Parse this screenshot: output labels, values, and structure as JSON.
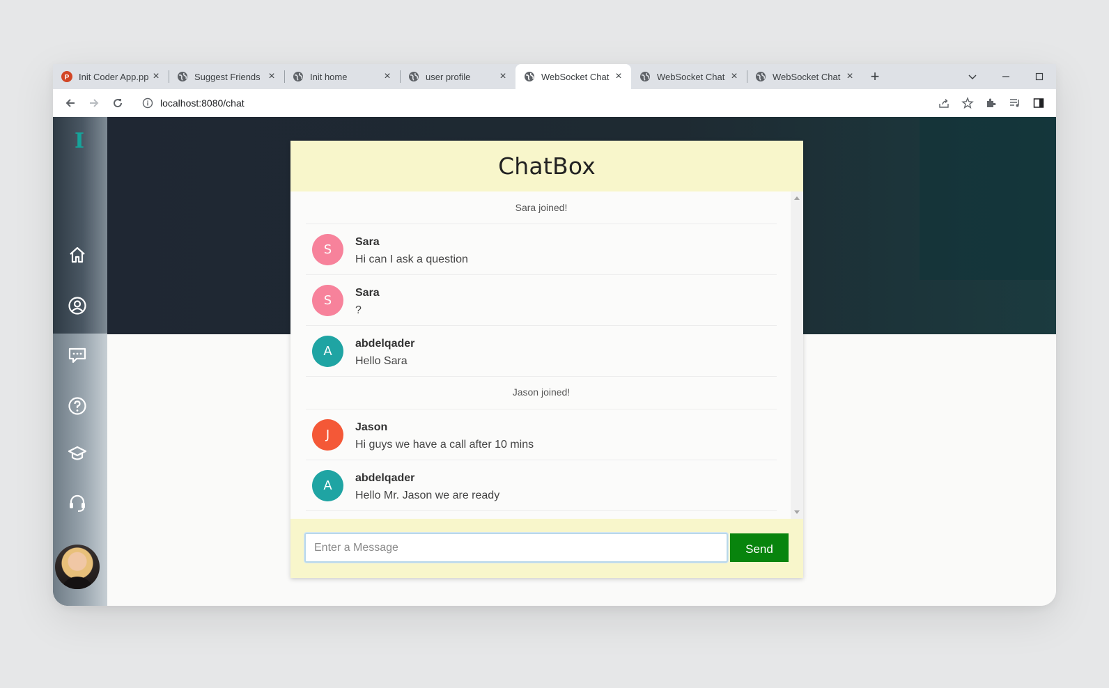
{
  "browser": {
    "tabs": [
      {
        "title": "Init Coder App.pp",
        "favicon": "powerpoint-icon",
        "active": false
      },
      {
        "title": "Suggest Friends",
        "favicon": "globe-icon",
        "active": false
      },
      {
        "title": "Init home",
        "favicon": "globe-icon",
        "active": false
      },
      {
        "title": "user profile",
        "favicon": "globe-icon",
        "active": false
      },
      {
        "title": "WebSocket Chat",
        "favicon": "globe-icon",
        "active": true
      },
      {
        "title": "WebSocket Chat",
        "favicon": "globe-icon",
        "active": false
      },
      {
        "title": "WebSocket Chat",
        "favicon": "globe-icon",
        "active": false
      }
    ],
    "new_tab_label": "+",
    "url": "localhost:8080/chat"
  },
  "sidebar": {
    "logo": "I",
    "items": [
      "home-icon",
      "profile-icon",
      "chat-icon",
      "help-icon",
      "courses-icon",
      "support-icon"
    ]
  },
  "chat": {
    "title": "ChatBox",
    "events": [
      "Sara joined!",
      "Jason joined!"
    ],
    "messages": [
      {
        "initial": "S",
        "name": "Sara",
        "text": "Hi can I ask a question",
        "color": "#f7829b"
      },
      {
        "initial": "S",
        "name": "Sara",
        "text": "?",
        "color": "#f7829b"
      },
      {
        "initial": "A",
        "name": "abdelqader",
        "text": "Hello Sara",
        "color": "#1fa4a3"
      },
      {
        "initial": "J",
        "name": "Jason",
        "text": "Hi guys we have a call after 10 mins",
        "color": "#f45837"
      },
      {
        "initial": "A",
        "name": "abdelqader",
        "text": "Hello Mr. Jason we are ready",
        "color": "#1fa4a3"
      }
    ],
    "input_placeholder": "Enter a Message",
    "send_label": "Send"
  },
  "colors": {
    "header_bg": "#f8f6cb",
    "send_button": "#08840d",
    "logo": "#16a39a"
  }
}
